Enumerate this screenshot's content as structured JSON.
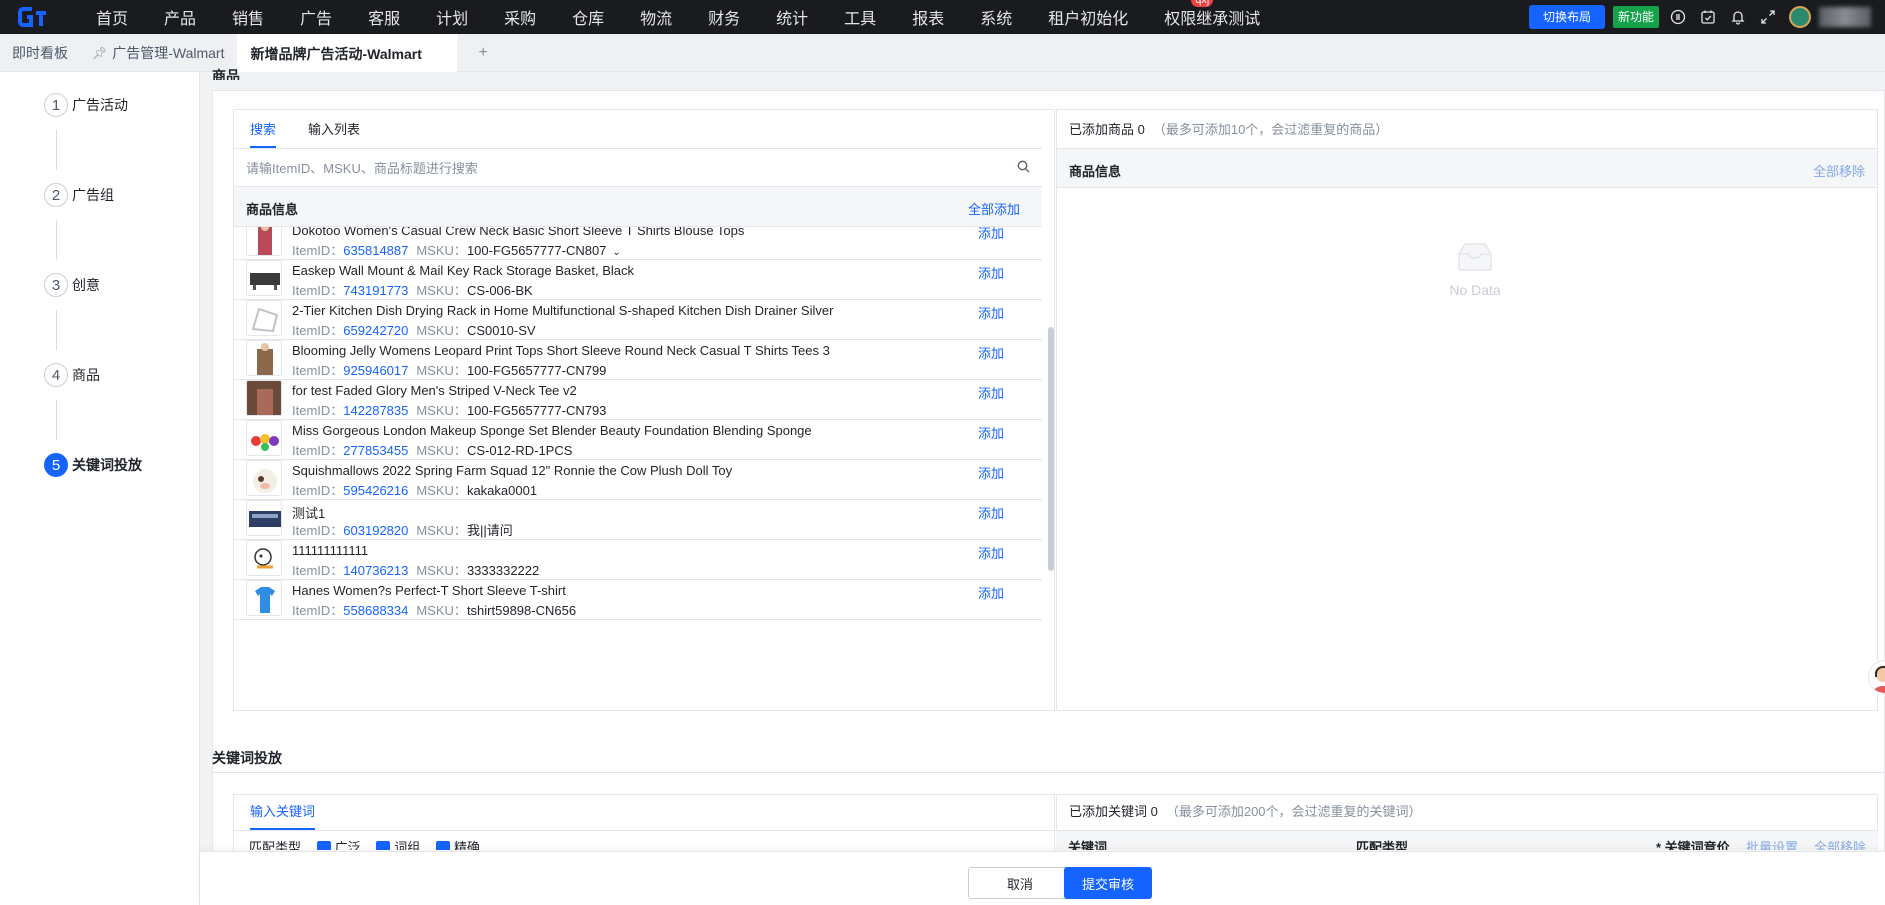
{
  "nav": {
    "menu": [
      "首页",
      "产品",
      "销售",
      "广告",
      "客服",
      "计划",
      "采购",
      "仓库",
      "物流",
      "财务",
      "统计",
      "工具",
      "报表",
      "系统",
      "租户初始化",
      "权限继承测试"
    ],
    "badge": "qxj",
    "layout_button": "切换布局",
    "new_feature": "新功能"
  },
  "tabs": {
    "items": [
      "即时看板",
      "广告管理-Walmart",
      "新增品牌广告活动-Walmart"
    ],
    "add": "+"
  },
  "steps": [
    {
      "num": "1",
      "label": "广告活动"
    },
    {
      "num": "2",
      "label": "广告组"
    },
    {
      "num": "3",
      "label": "创意"
    },
    {
      "num": "4",
      "label": "商品"
    },
    {
      "num": "5",
      "label": "关键词投放"
    }
  ],
  "products_section": {
    "title": "商品",
    "tabs": [
      "搜索",
      "输入列表"
    ],
    "search_placeholder": "请输ItemID、MSKU、商品标题进行搜索",
    "list_header": "商品信息",
    "add_all": "全部添加",
    "add_label": "添加",
    "itemid_label": "ItemID：",
    "msku_label": "MSKU：",
    "items": [
      {
        "title": "Dokotoo Women's Casual Crew Neck Basic Short Sleeve T Shirts Blouse Tops",
        "itemid": "635814887",
        "msku": "100-FG5657777-CN807"
      },
      {
        "title": "Easkep Wall Mount & Mail Key Rack Storage Basket, Black",
        "itemid": "743191773",
        "msku": "CS-006-BK"
      },
      {
        "title": "2-Tier Kitchen Dish Drying Rack in Home Multifunctional S-shaped Kitchen Dish Drainer Silver",
        "itemid": "659242720",
        "msku": "CS0010-SV"
      },
      {
        "title": "Blooming Jelly Womens Leopard Print Tops Short Sleeve Round Neck Casual T Shirts Tees 3",
        "itemid": "925946017",
        "msku": "100-FG5657777-CN799"
      },
      {
        "title": "for test Faded Glory Men's Striped V-Neck Tee v2",
        "itemid": "142287835",
        "msku": "100-FG5657777-CN793"
      },
      {
        "title": "Miss Gorgeous London Makeup Sponge Set Blender Beauty Foundation Blending Sponge",
        "itemid": "277853455",
        "msku": "CS-012-RD-1PCS"
      },
      {
        "title": "Squishmallows 2022 Spring Farm Squad 12\" Ronnie the Cow Plush Doll Toy",
        "itemid": "595426216",
        "msku": "kakaka0001"
      },
      {
        "title": "测试1",
        "itemid": "603192820",
        "msku": "我||请问"
      },
      {
        "title": "111111111111",
        "itemid": "140736213",
        "msku": "3333332222"
      },
      {
        "title": "Hanes Women?s Perfect-T Short Sleeve T-shirt",
        "itemid": "558688334",
        "msku": "tshirt59898-CN656"
      }
    ],
    "added_label": "已添加商品 0",
    "added_hint": "（最多可添加10个，会过滤重复的商品）",
    "right_header": "商品信息",
    "remove_all": "全部移除",
    "empty": "No Data"
  },
  "keywords_section": {
    "title": "关键词投放",
    "tab": "输入关键词",
    "added_label": "已添加关键词 0",
    "added_hint": "（最多可添加200个，会过滤重复的关键词）",
    "match_type": "匹配类型",
    "broad": "广泛",
    "phrase": "词组",
    "exact": "精确",
    "col_keyword": "关键词",
    "col_match": "匹配类型",
    "col_bid": "* 关键词竞价",
    "batch_set": "批量设置",
    "remove_all": "全部移除"
  },
  "footer": {
    "cancel": "取消",
    "submit": "提交审核"
  },
  "colors": {
    "primary": "#1664ff",
    "nav_bg": "#191b1f",
    "new_feature": "#14a34a"
  }
}
